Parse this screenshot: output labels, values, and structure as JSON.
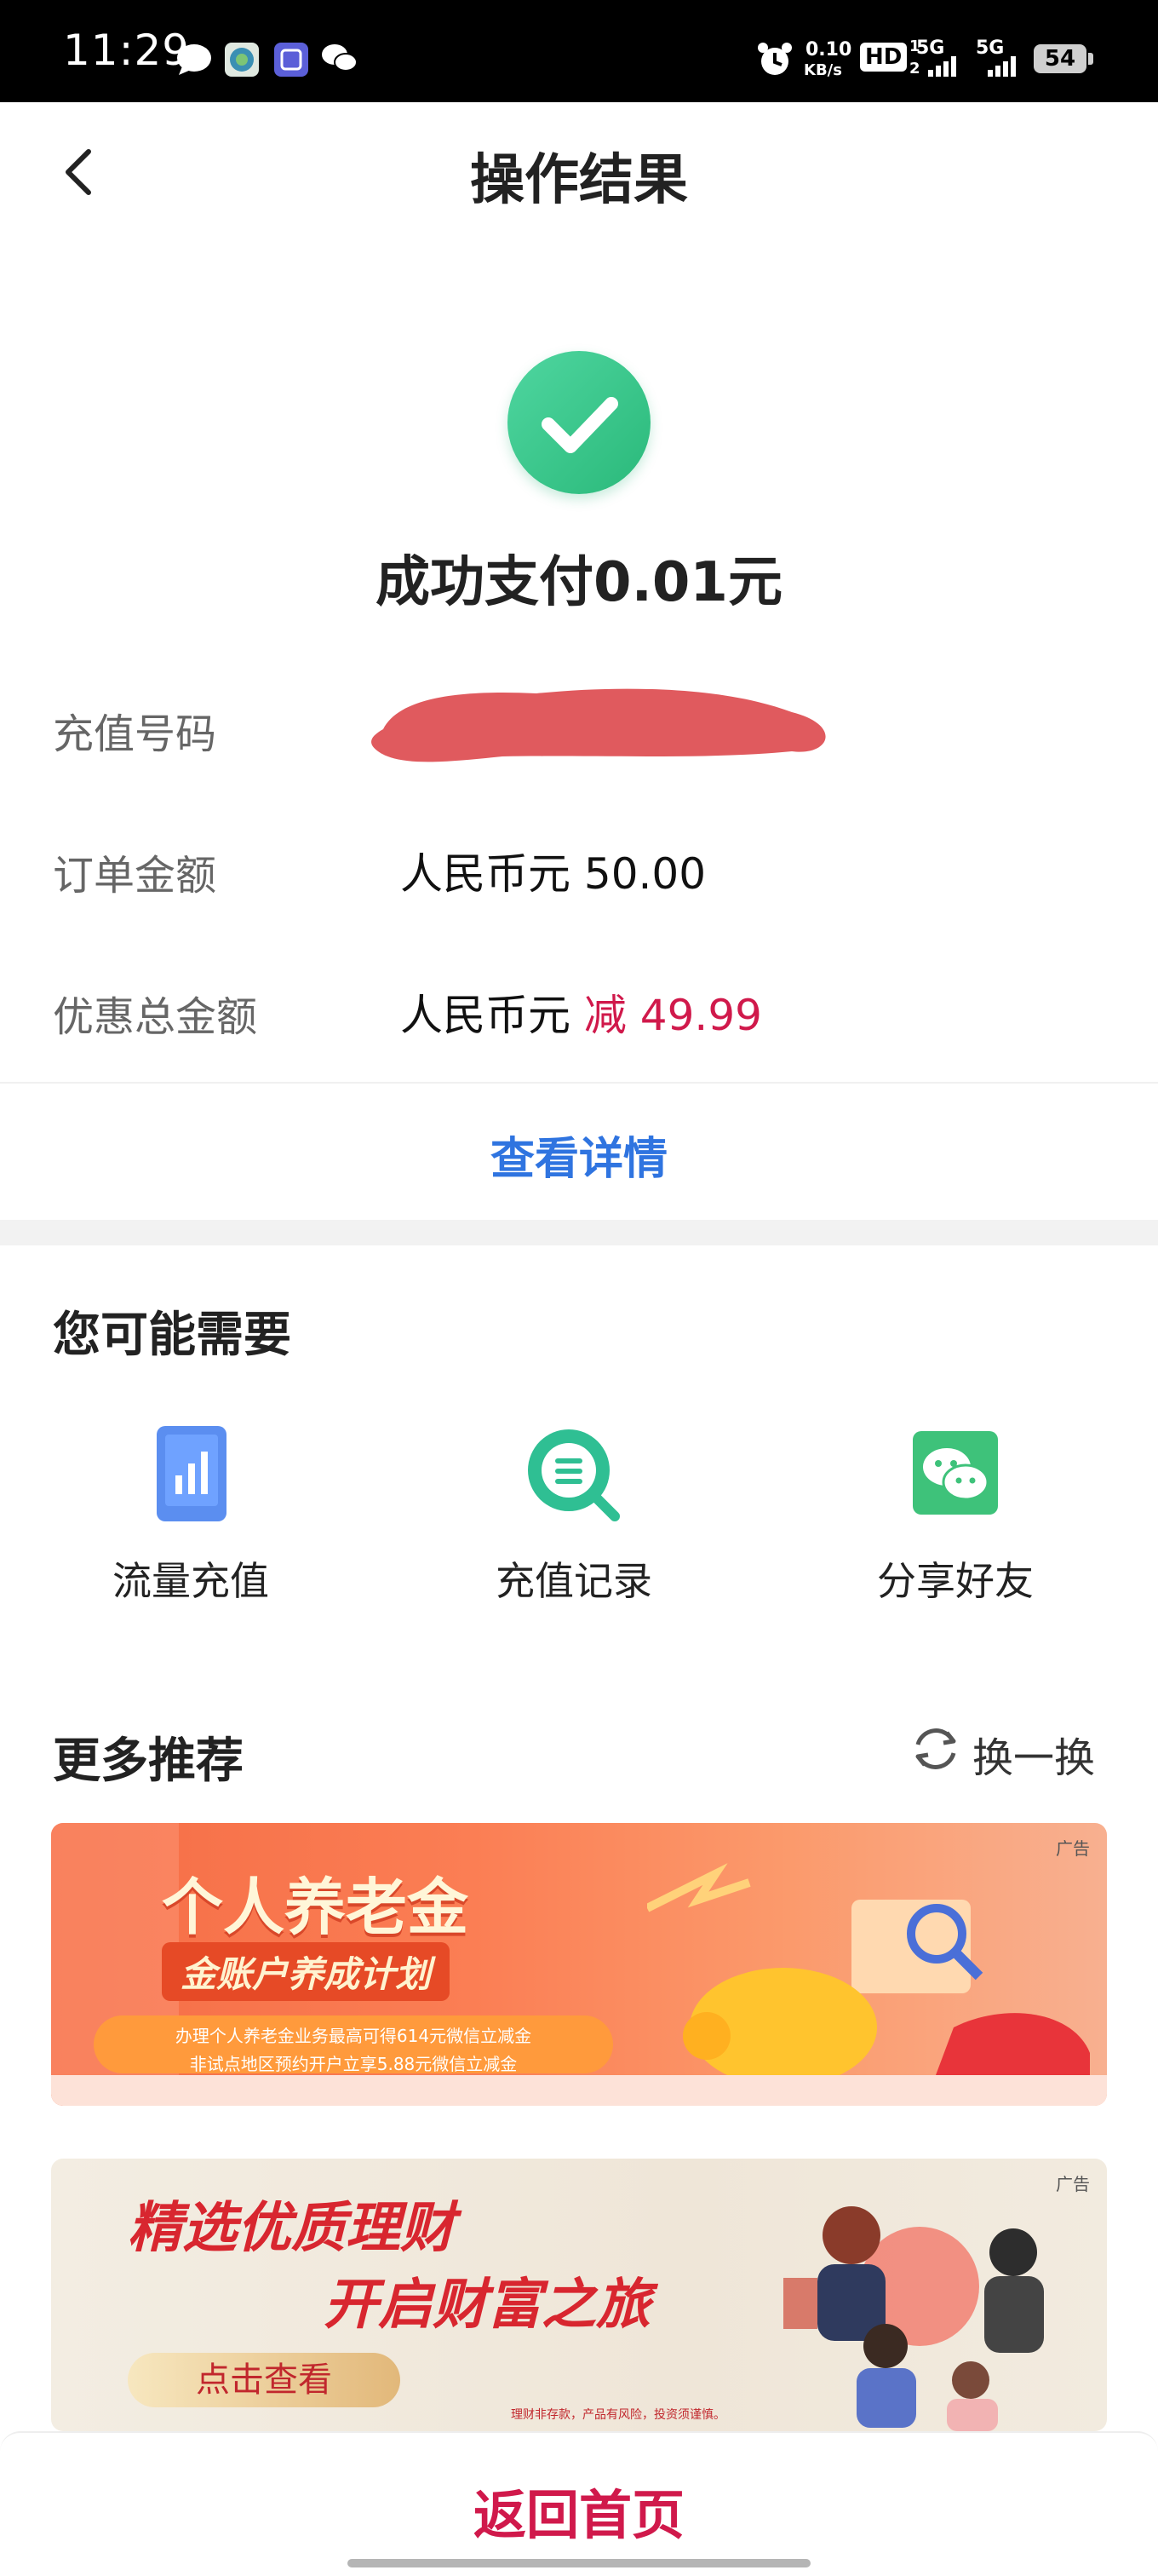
{
  "status_bar": {
    "time": "11:29",
    "speed_value": "0.10",
    "speed_unit": "KB/s",
    "hd_label": "HD",
    "sim1": "1",
    "sim2": "2",
    "net1": "5G",
    "net2": "5G",
    "battery": "54",
    "icons": [
      "chat-bubble-icon",
      "globe-app-icon",
      "tieba-app-icon",
      "wechat-icon",
      "alarm-icon"
    ]
  },
  "header": {
    "title": "操作结果"
  },
  "result": {
    "status_text": "成功支付0.01元",
    "rows": [
      {
        "label": "充值号码",
        "value": ""
      },
      {
        "label": "订单金额",
        "value": "人民币元 50.00"
      },
      {
        "label": "优惠总金额",
        "value_prefix": "人民币元",
        "value_highlight": "减 49.99"
      }
    ],
    "detail_link": "查看详情"
  },
  "suggestions": {
    "title": "您可能需要",
    "items": [
      {
        "label": "流量充值",
        "icon": "data-recharge-icon"
      },
      {
        "label": "充值记录",
        "icon": "recharge-record-icon"
      },
      {
        "label": "分享好友",
        "icon": "wechat-share-icon"
      }
    ]
  },
  "recommend": {
    "title": "更多推荐",
    "refresh_label": "换一换",
    "banners": [
      {
        "ad_tag": "广告",
        "headline": "个人养老金",
        "subhead": "金账户养成计划",
        "line1": "办理个人养老金业务最高可得614元微信立减金",
        "line2": "非试点地区预约开户立享5.88元微信立减金"
      },
      {
        "ad_tag": "广告",
        "headline": "精选优质理财",
        "subhead": "开启财富之旅",
        "button": "点击查看",
        "disclaimer": "理财非存款，产品有风险，投资须谨慎。"
      }
    ]
  },
  "footer": {
    "home_button": "返回首页"
  },
  "colors": {
    "accent_red": "#d0194b",
    "link_blue": "#2f74e0",
    "success_green": "#2ab97a"
  }
}
